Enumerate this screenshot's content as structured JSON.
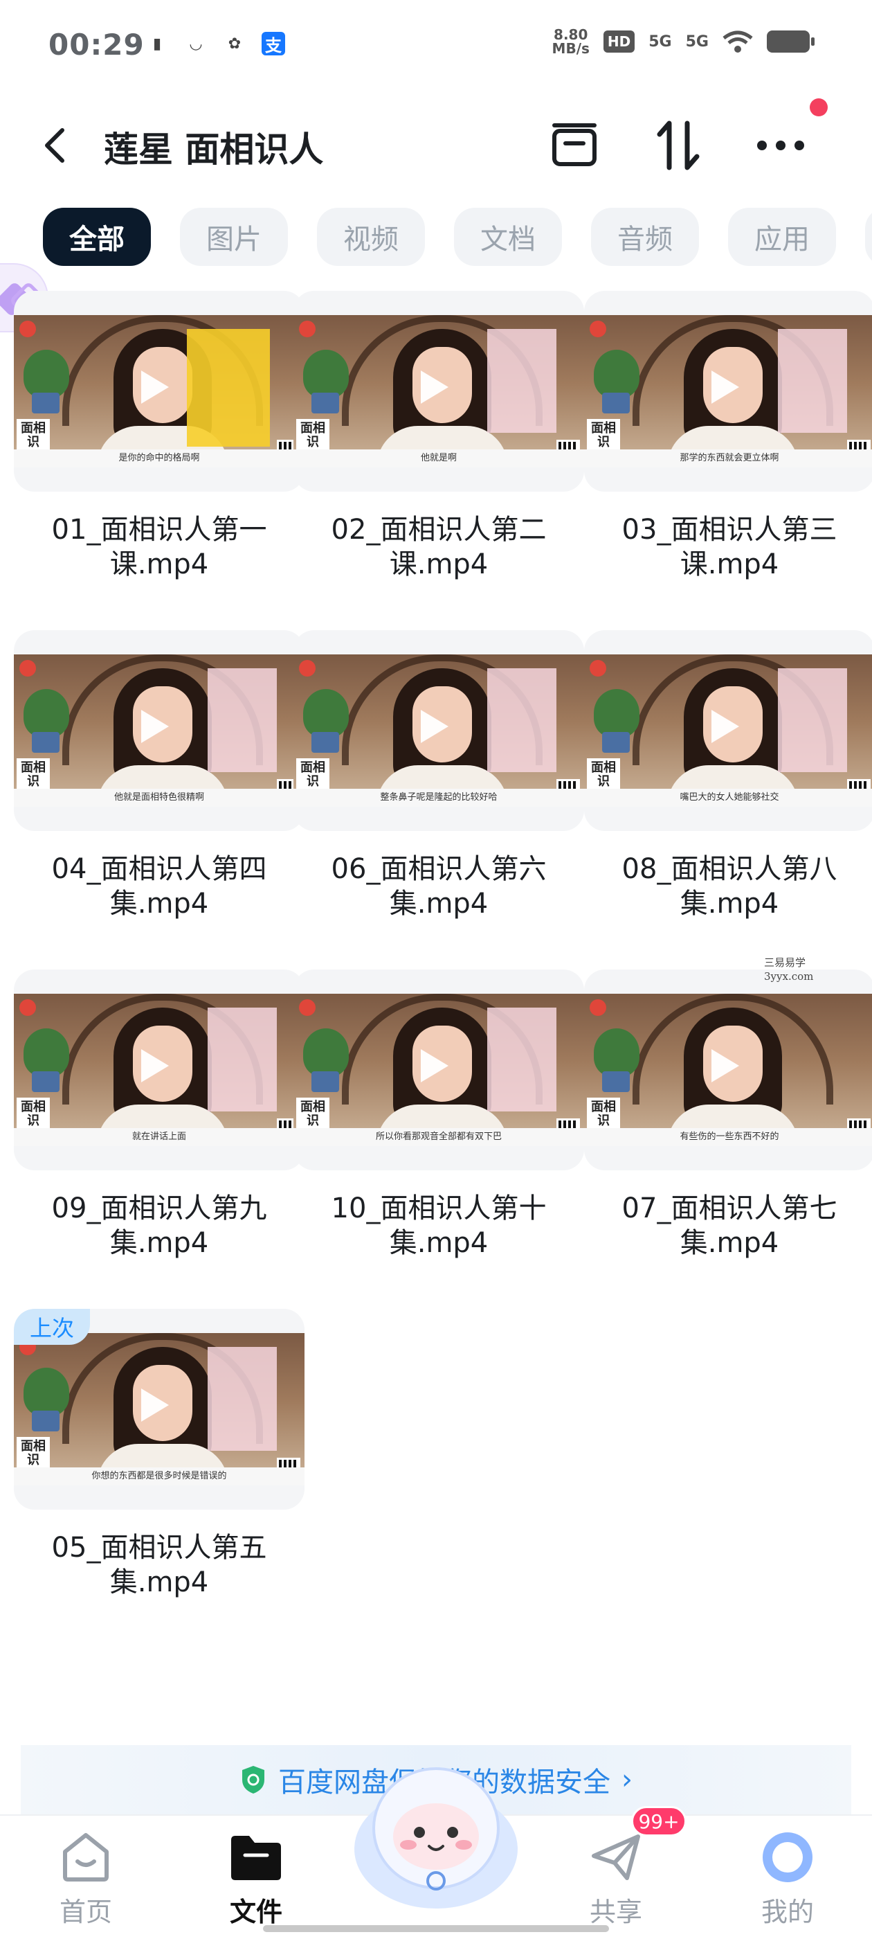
{
  "status_bar": {
    "time": "00:29",
    "net_speed_value": "8.80",
    "net_speed_unit": "MB/s",
    "hd_label": "HD",
    "signal1": "5G",
    "signal2": "5G",
    "alipay": "支"
  },
  "header": {
    "title": "莲星 面相识人"
  },
  "tabs": [
    "全部",
    "图片",
    "视频",
    "文档",
    "音频",
    "应用"
  ],
  "files": [
    {
      "name": "01_面相识人第一课.mp4",
      "subtitle": "是你的命中的格局啊",
      "panel": "yellow"
    },
    {
      "name": "02_面相识人第二课.mp4",
      "subtitle": "他就是啊",
      "panel": "pink"
    },
    {
      "name": "03_面相识人第三课.mp4",
      "subtitle": "那学的东西就会更立体啊",
      "panel": "pink"
    },
    {
      "name": "04_面相识人第四集.mp4",
      "subtitle": "他就是面相特色很精啊",
      "panel": "pink"
    },
    {
      "name": "06_面相识人第六集.mp4",
      "subtitle": "整条鼻子呢是隆起的比较好哈",
      "panel": "pink"
    },
    {
      "name": "08_面相识人第八集.mp4",
      "subtitle": "嘴巴大的女人她能够社交",
      "panel": "pink"
    },
    {
      "name": "09_面相识人第九集.mp4",
      "subtitle": "就在讲话上面",
      "panel": "pink"
    },
    {
      "name": "10_面相识人第十集.mp4",
      "subtitle": "所以你看那观音全部都有双下巴",
      "panel": "pink"
    },
    {
      "name": "07_面相识人第七集.mp4",
      "subtitle": "有些伤的一些东西不好的",
      "panel": "none"
    },
    {
      "name": "05_面相识人第五集.mp4",
      "subtitle": "你想的东西都是很多时候是错误的",
      "panel": "pink",
      "badge": "上次"
    }
  ],
  "watermark": {
    "line1": "三易易学",
    "line2": "3yyx.com"
  },
  "banner": {
    "text": "百度网盘保护您的数据安全"
  },
  "bottom_nav": {
    "home": "首页",
    "files": "文件",
    "share": "共享",
    "mine": "我的",
    "share_badge": "99+"
  },
  "colors": {
    "accent": "#1a8cff",
    "active_tab": "#0b1a2b",
    "badge": "#ff3b6b"
  }
}
